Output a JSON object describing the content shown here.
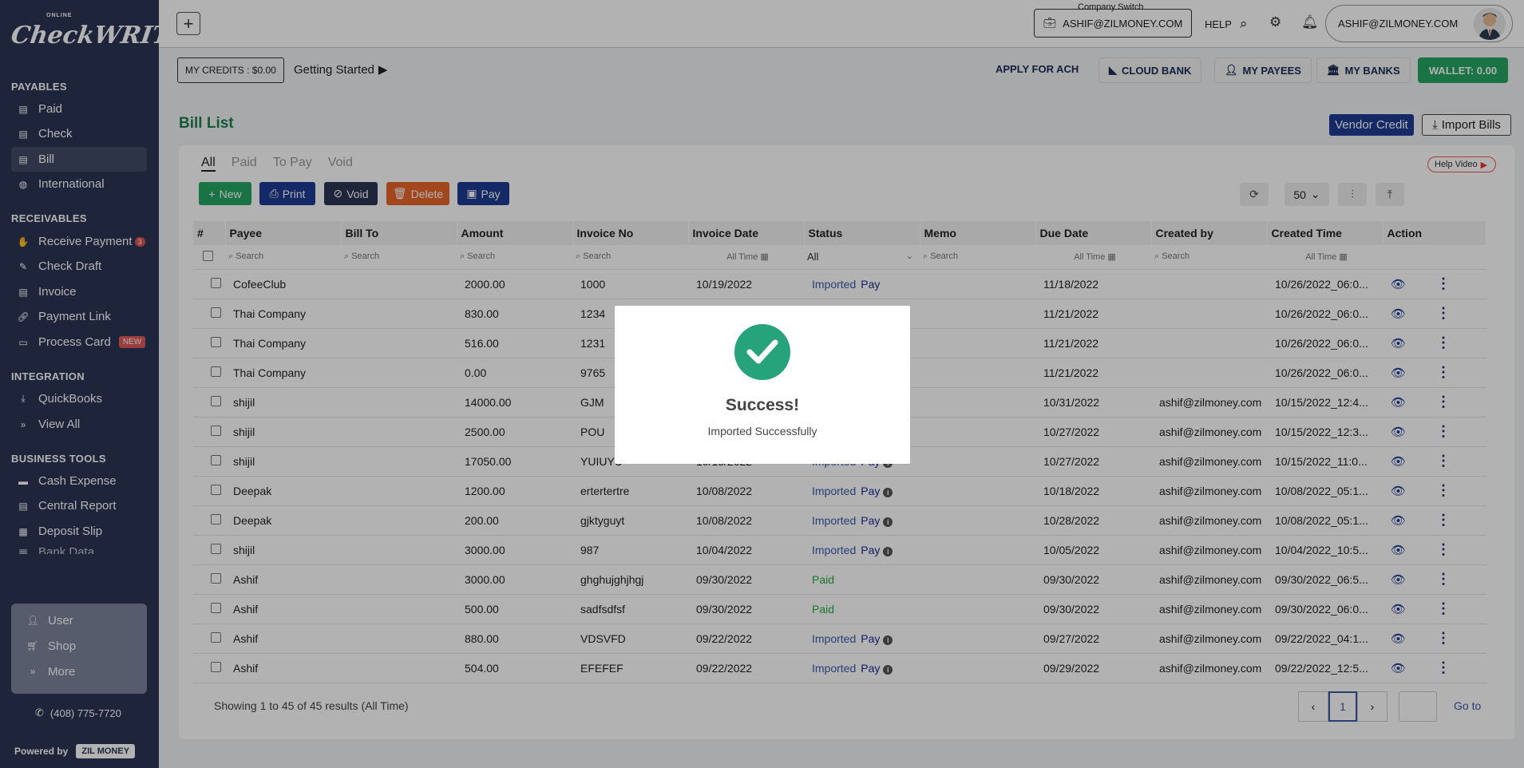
{
  "logo": {
    "small": "ONLINE",
    "big": "CheckWRITER"
  },
  "sidebar": {
    "sections": [
      "PAYABLES",
      "RECEIVABLES",
      "INTEGRATION",
      "BUSINESS TOOLS"
    ],
    "payables": [
      {
        "label": "Paid",
        "icon": "document-icon"
      },
      {
        "label": "Check",
        "icon": "check-icon"
      },
      {
        "label": "Bill",
        "icon": "bill-icon"
      },
      {
        "label": "International",
        "icon": "globe-icon"
      }
    ],
    "receivables": [
      {
        "label": "Receive Payment",
        "icon": "hand-coin-icon",
        "badge": "3"
      },
      {
        "label": "Check Draft",
        "icon": "pen-icon"
      },
      {
        "label": "Invoice",
        "icon": "invoice-icon"
      },
      {
        "label": "Payment Link",
        "icon": "link-icon"
      },
      {
        "label": "Process Card",
        "icon": "card-icon",
        "badge": "NEW"
      }
    ],
    "integration": [
      {
        "label": "QuickBooks",
        "icon": "download-icon"
      },
      {
        "label": "View All",
        "icon": "double-chevron-icon"
      }
    ],
    "business_tools": [
      {
        "label": "Cash Expense",
        "icon": "cash-icon"
      },
      {
        "label": "Central Report",
        "icon": "report-icon"
      },
      {
        "label": "Deposit Slip",
        "icon": "slip-icon"
      },
      {
        "label": "Bank Data",
        "icon": "bank-icon"
      }
    ],
    "user_menu": [
      {
        "label": "User",
        "icon": "user-icon"
      },
      {
        "label": "Shop",
        "icon": "cart-icon"
      },
      {
        "label": "More",
        "icon": "double-chevron-icon"
      }
    ],
    "phone": "(408) 775-7720",
    "powered_by": "Powered by",
    "zil": "ZIL MONEY"
  },
  "topbar": {
    "company_switch_label": "Company Switch",
    "company_switch": "ASHIF@ZILMONEY.COM",
    "help": "HELP",
    "user": "ASHIF@ZILMONEY.COM"
  },
  "subbar": {
    "credits": "MY CREDITS : $0.00",
    "getting_started": "Getting Started",
    "ach": "APPLY FOR ACH",
    "cloud_bank": "CLOUD BANK",
    "my_payees": "MY PAYEES",
    "my_banks": "MY BANKS",
    "wallet": "WALLET: 0.00"
  },
  "page": {
    "title": "Bill List",
    "vendor_credit": "Vendor Credit",
    "import_bills": "Import Bills"
  },
  "tabs": [
    "All",
    "Paid",
    "To Pay",
    "Void"
  ],
  "help_video": "Help Video",
  "actions": {
    "new": "New",
    "print": "Print",
    "void": "Void",
    "delete": "Delete",
    "pay": "Pay"
  },
  "colors": {
    "new": "#26a563",
    "print": "#1d3c92",
    "void": "#2b3555",
    "delete": "#e8652b",
    "pay": "#1d3c92"
  },
  "per_page": "50",
  "columns": [
    "#",
    "Payee",
    "Bill To",
    "Amount",
    "Invoice No",
    "Invoice Date",
    "Status",
    "Memo",
    "Due Date",
    "Created by",
    "Created Time",
    "Action"
  ],
  "filters": {
    "search": "Search",
    "all_time": "All Time",
    "status": "All"
  },
  "rows": [
    {
      "payee": "CofeeClub",
      "amount": "2000.00",
      "invoice": "1000",
      "date": "10/19/2022",
      "status": "Imported",
      "pay": "Pay",
      "info": false,
      "due": "11/18/2022",
      "by": "",
      "created": "10/26/2022_06:0..."
    },
    {
      "payee": "Thai Company",
      "amount": "830.00",
      "invoice": "1234",
      "date": "",
      "status": "",
      "pay": "",
      "info": false,
      "due": "11/21/2022",
      "by": "",
      "created": "10/26/2022_06:0..."
    },
    {
      "payee": "Thai Company",
      "amount": "516.00",
      "invoice": "1231",
      "date": "",
      "status": "",
      "pay": "",
      "info": false,
      "due": "11/21/2022",
      "by": "",
      "created": "10/26/2022_06:0..."
    },
    {
      "payee": "Thai Company",
      "amount": "0.00",
      "invoice": "9765",
      "date": "",
      "status": "",
      "pay": "",
      "info": false,
      "due": "11/21/2022",
      "by": "",
      "created": "10/26/2022_06:0..."
    },
    {
      "payee": "shijil",
      "amount": "14000.00",
      "invoice": "GJM",
      "date": "",
      "status": "",
      "pay": "",
      "info": false,
      "due": "10/31/2022",
      "by": "ashif@zilmoney.com",
      "created": "10/15/2022_12:4..."
    },
    {
      "payee": "shijil",
      "amount": "2500.00",
      "invoice": "POU",
      "date": "",
      "status": "",
      "pay": "",
      "info": false,
      "due": "10/27/2022",
      "by": "ashif@zilmoney.com",
      "created": "10/15/2022_12:3..."
    },
    {
      "payee": "shijil",
      "amount": "17050.00",
      "invoice": "YUIUYU",
      "date": "10/15/2022",
      "status": "Imported",
      "pay": "Pay",
      "info": true,
      "due": "10/27/2022",
      "by": "ashif@zilmoney.com",
      "created": "10/15/2022_11:0..."
    },
    {
      "payee": "Deepak",
      "amount": "1200.00",
      "invoice": "ertertertre",
      "date": "10/08/2022",
      "status": "Imported",
      "pay": "Pay",
      "info": true,
      "due": "10/18/2022",
      "by": "ashif@zilmoney.com",
      "created": "10/08/2022_05:1..."
    },
    {
      "payee": "Deepak",
      "amount": "200.00",
      "invoice": "gjktyguyt",
      "date": "10/08/2022",
      "status": "Imported",
      "pay": "Pay",
      "info": true,
      "due": "10/28/2022",
      "by": "ashif@zilmoney.com",
      "created": "10/08/2022_05:1..."
    },
    {
      "payee": "shijil",
      "amount": "3000.00",
      "invoice": "987",
      "date": "10/04/2022",
      "status": "Imported",
      "pay": "Pay",
      "info": true,
      "due": "10/05/2022",
      "by": "ashif@zilmoney.com",
      "created": "10/04/2022_10:5..."
    },
    {
      "payee": "Ashif",
      "amount": "3000.00",
      "invoice": "ghghujghjhgj",
      "date": "09/30/2022",
      "status": "Paid",
      "pay": "",
      "info": false,
      "due": "09/30/2022",
      "by": "ashif@zilmoney.com",
      "created": "09/30/2022_06:5..."
    },
    {
      "payee": "Ashif",
      "amount": "500.00",
      "invoice": "sadfsdfsf",
      "date": "09/30/2022",
      "status": "Paid",
      "pay": "",
      "info": false,
      "due": "09/30/2022",
      "by": "ashif@zilmoney.com",
      "created": "09/30/2022_06:0..."
    },
    {
      "payee": "Ashif",
      "amount": "880.00",
      "invoice": "VDSVFD",
      "date": "09/22/2022",
      "status": "Imported",
      "pay": "Pay",
      "info": true,
      "due": "09/27/2022",
      "by": "ashif@zilmoney.com",
      "created": "09/22/2022_04:1..."
    },
    {
      "payee": "Ashif",
      "amount": "504.00",
      "invoice": "EFEFEF",
      "date": "09/22/2022",
      "status": "Imported",
      "pay": "Pay",
      "info": true,
      "due": "09/29/2022",
      "by": "ashif@zilmoney.com",
      "created": "09/22/2022_12:5..."
    }
  ],
  "footer": {
    "showing": "Showing 1 to 45 of 45 results (All Time)",
    "page": "1",
    "goto": "Go to"
  },
  "modal": {
    "title": "Success!",
    "message": "Imported Successfully"
  }
}
